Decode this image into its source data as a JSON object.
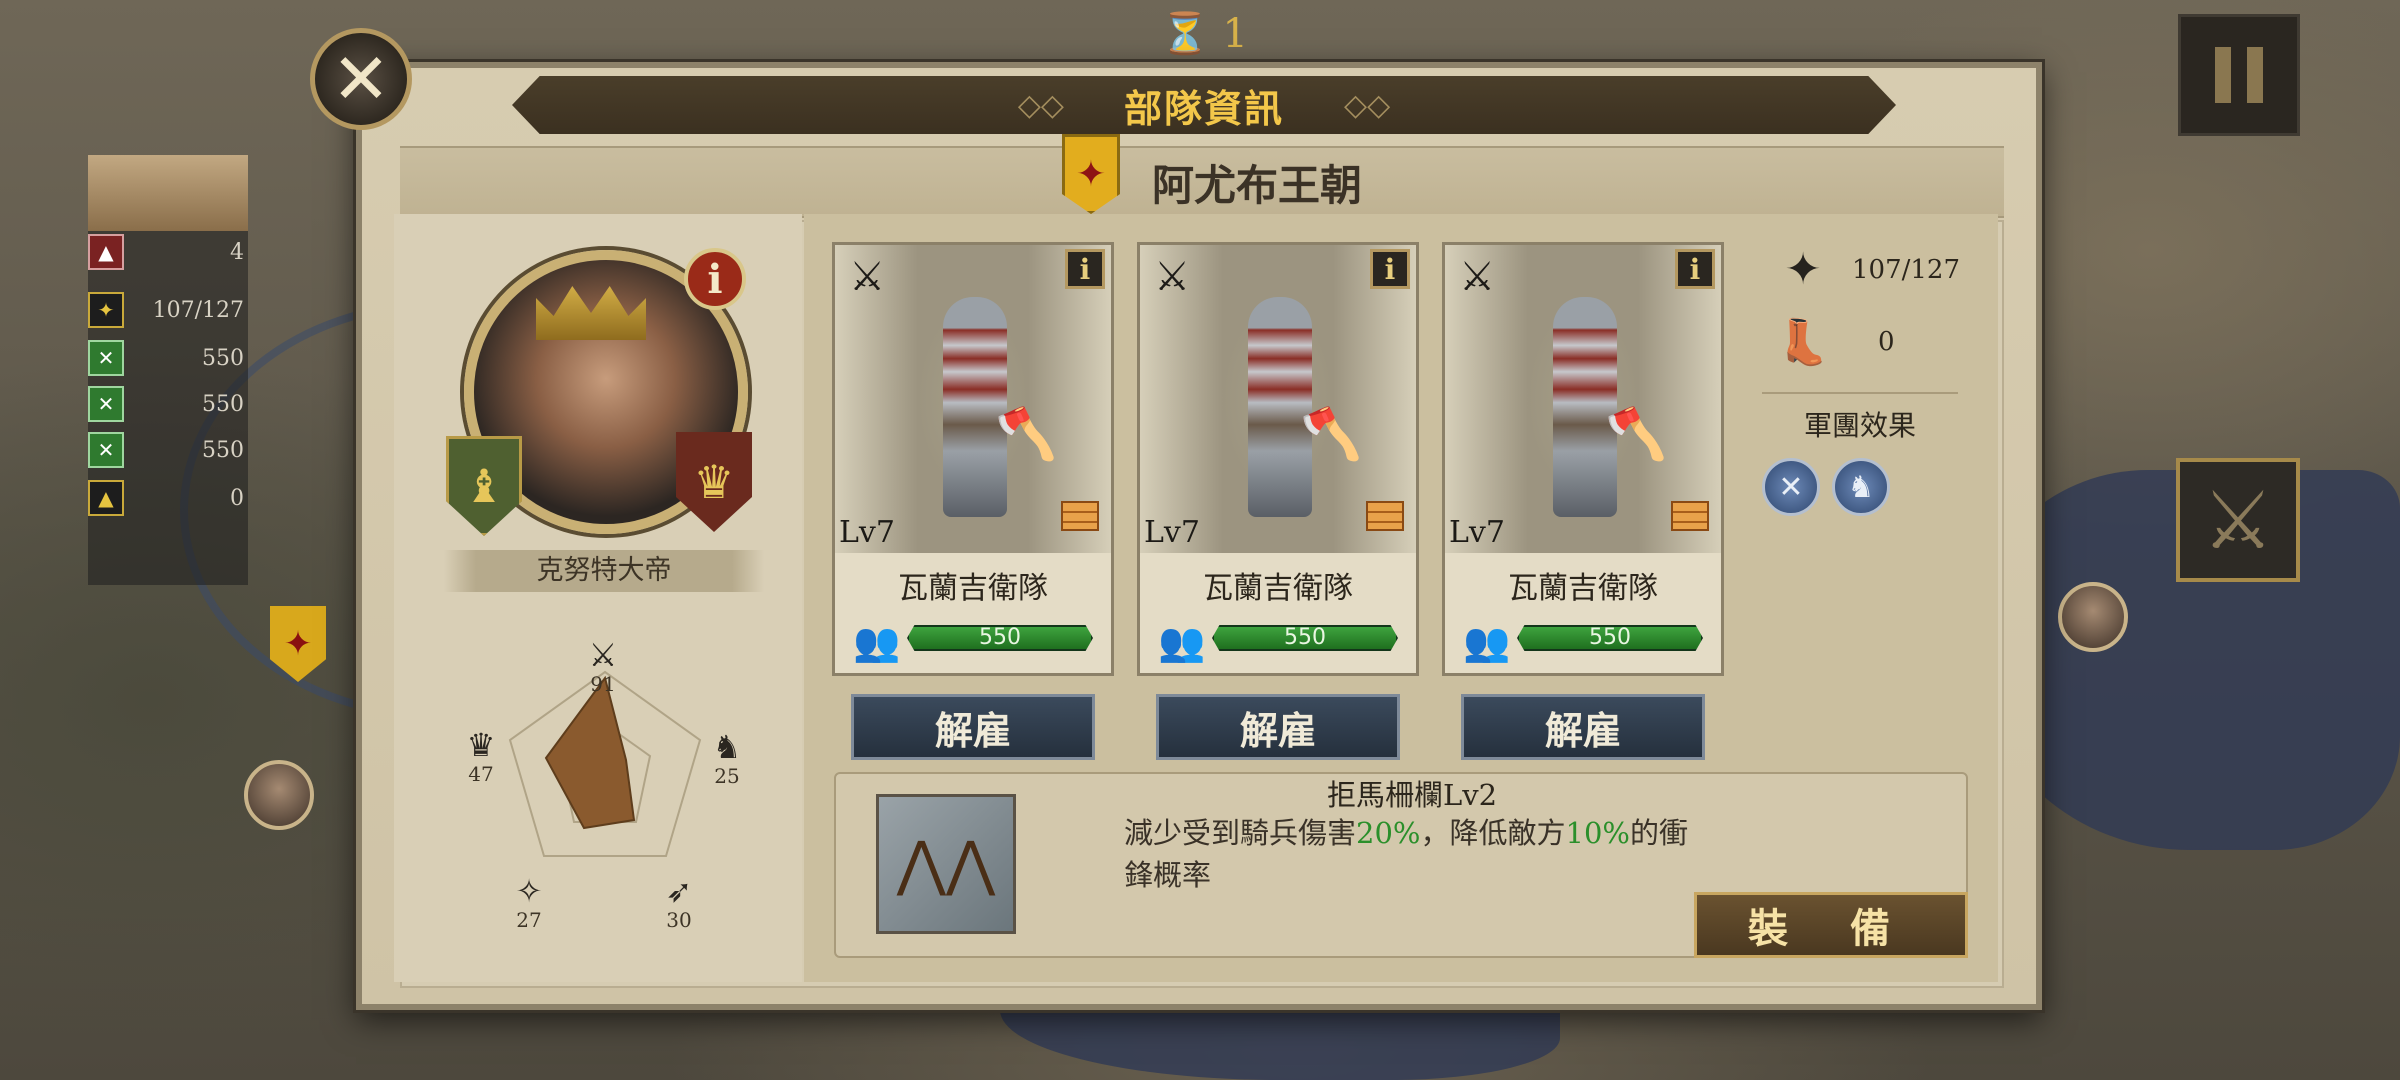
{
  "hud": {
    "turn_count": "1"
  },
  "mini_panel": {
    "rows": [
      {
        "icon": "boot-icon",
        "value": "4"
      },
      {
        "icon": "eagle-icon",
        "value": "107/127"
      },
      {
        "icon": "swords-icon",
        "value": "550"
      },
      {
        "icon": "swords-icon",
        "value": "550"
      },
      {
        "icon": "swords-icon",
        "value": "550"
      },
      {
        "icon": "boot-icon",
        "value": "0"
      }
    ]
  },
  "dialog": {
    "title": "部隊資訊",
    "dynasty": "阿尤布王朝",
    "commander": {
      "name": "克努特大帝",
      "stats": {
        "attack": "91",
        "cavalry": "25",
        "ranged": "30",
        "defense": "27",
        "leadership": "47"
      }
    },
    "units": [
      {
        "level": "Lv7",
        "name": "瓦蘭吉衛隊",
        "troops": "550",
        "dismiss_label": "解雇"
      },
      {
        "level": "Lv7",
        "name": "瓦蘭吉衛隊",
        "troops": "550",
        "dismiss_label": "解雇"
      },
      {
        "level": "Lv7",
        "name": "瓦蘭吉衛隊",
        "troops": "550",
        "dismiss_label": "解雇"
      }
    ],
    "army_stats": {
      "supply": "107/127",
      "movement": "0",
      "legion_effect_title": "軍團效果"
    },
    "skill": {
      "name": "拒馬柵欄Lv2",
      "desc_part1": "減少受到騎兵傷害",
      "desc_value1": "20%",
      "desc_part2": "，降低敵方",
      "desc_value2": "10%",
      "desc_part3": "的衝鋒概率",
      "equip_label": "裝 備"
    },
    "colors": {
      "title_gold": "#f3c74a",
      "troop_bar_green": "#3ea33e",
      "highlight_green": "#2b8f2b",
      "dynasty_badge": "#e2ad1e"
    }
  }
}
